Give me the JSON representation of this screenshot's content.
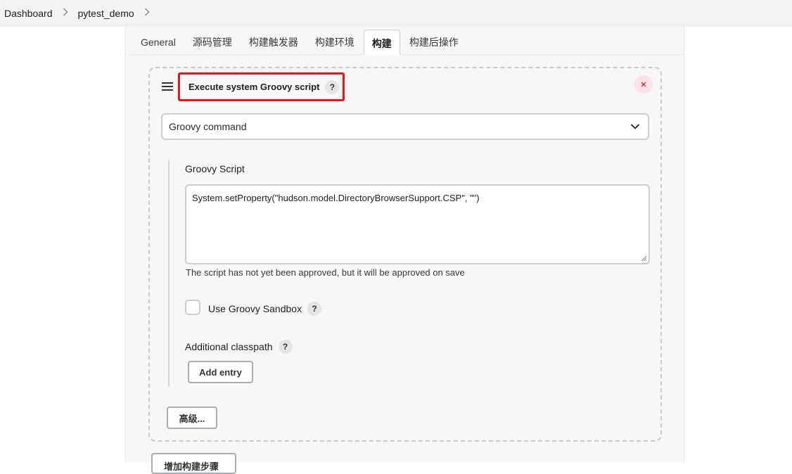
{
  "breadcrumb": {
    "items": [
      "Dashboard",
      "pytest_demo"
    ],
    "separator": ">"
  },
  "tabs": [
    {
      "label": "General",
      "active": false
    },
    {
      "label": "源码管理",
      "active": false
    },
    {
      "label": "构建触发器",
      "active": false
    },
    {
      "label": "构建环境",
      "active": false
    },
    {
      "label": "构建",
      "active": true
    },
    {
      "label": "构建后操作",
      "active": false
    }
  ],
  "step": {
    "title": "Execute system Groovy script",
    "help": "?",
    "delete_icon": "close-icon",
    "highlight_color": "#e6141c"
  },
  "source_select": {
    "value": "Groovy command"
  },
  "groovy": {
    "label": "Groovy Script",
    "script": "System.setProperty(\"hudson.model.DirectoryBrowserSupport.CSP\", \"\")",
    "hint": "The script has not yet been approved, but it will be approved on save",
    "sandbox_label": "Use Groovy Sandbox",
    "sandbox_checked": false,
    "classpath_label": "Additional classpath",
    "add_entry": "Add entry"
  },
  "advanced_button": "高级...",
  "add_step_button": "增加构建步骤"
}
